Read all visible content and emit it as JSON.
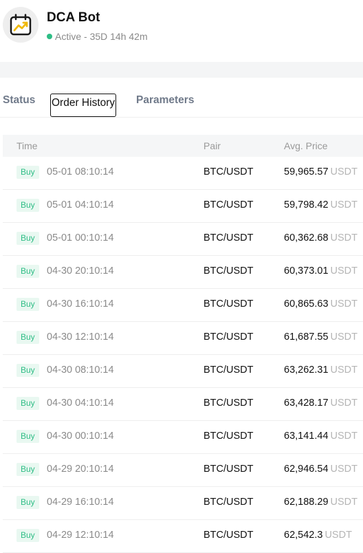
{
  "bot": {
    "name": "DCA Bot",
    "status": "Active",
    "runtime": "35D 14h 42m",
    "status_color": "#2ebd85"
  },
  "tabs": [
    {
      "label": "Status"
    },
    {
      "label": "Order History",
      "active": true
    },
    {
      "label": "Parameters"
    }
  ],
  "table": {
    "columns": {
      "time": "Time",
      "pair": "Pair",
      "price": "Avg. Price"
    },
    "rows": [
      {
        "side": "Buy",
        "time": "05-01 08:10:14",
        "pair": "BTC/USDT",
        "price": "59,965.57",
        "unit": "USDT"
      },
      {
        "side": "Buy",
        "time": "05-01 04:10:14",
        "pair": "BTC/USDT",
        "price": "59,798.42",
        "unit": "USDT"
      },
      {
        "side": "Buy",
        "time": "05-01 00:10:14",
        "pair": "BTC/USDT",
        "price": "60,362.68",
        "unit": "USDT"
      },
      {
        "side": "Buy",
        "time": "04-30 20:10:14",
        "pair": "BTC/USDT",
        "price": "60,373.01",
        "unit": "USDT"
      },
      {
        "side": "Buy",
        "time": "04-30 16:10:14",
        "pair": "BTC/USDT",
        "price": "60,865.63",
        "unit": "USDT"
      },
      {
        "side": "Buy",
        "time": "04-30 12:10:14",
        "pair": "BTC/USDT",
        "price": "61,687.55",
        "unit": "USDT"
      },
      {
        "side": "Buy",
        "time": "04-30 08:10:14",
        "pair": "BTC/USDT",
        "price": "63,262.31",
        "unit": "USDT"
      },
      {
        "side": "Buy",
        "time": "04-30 04:10:14",
        "pair": "BTC/USDT",
        "price": "63,428.17",
        "unit": "USDT"
      },
      {
        "side": "Buy",
        "time": "04-30 00:10:14",
        "pair": "BTC/USDT",
        "price": "63,141.44",
        "unit": "USDT"
      },
      {
        "side": "Buy",
        "time": "04-29 20:10:14",
        "pair": "BTC/USDT",
        "price": "62,946.54",
        "unit": "USDT"
      },
      {
        "side": "Buy",
        "time": "04-29 16:10:14",
        "pair": "BTC/USDT",
        "price": "62,188.29",
        "unit": "USDT"
      },
      {
        "side": "Buy",
        "time": "04-29 12:10:14",
        "pair": "BTC/USDT",
        "price": "62,542.3",
        "unit": "USDT"
      }
    ]
  }
}
